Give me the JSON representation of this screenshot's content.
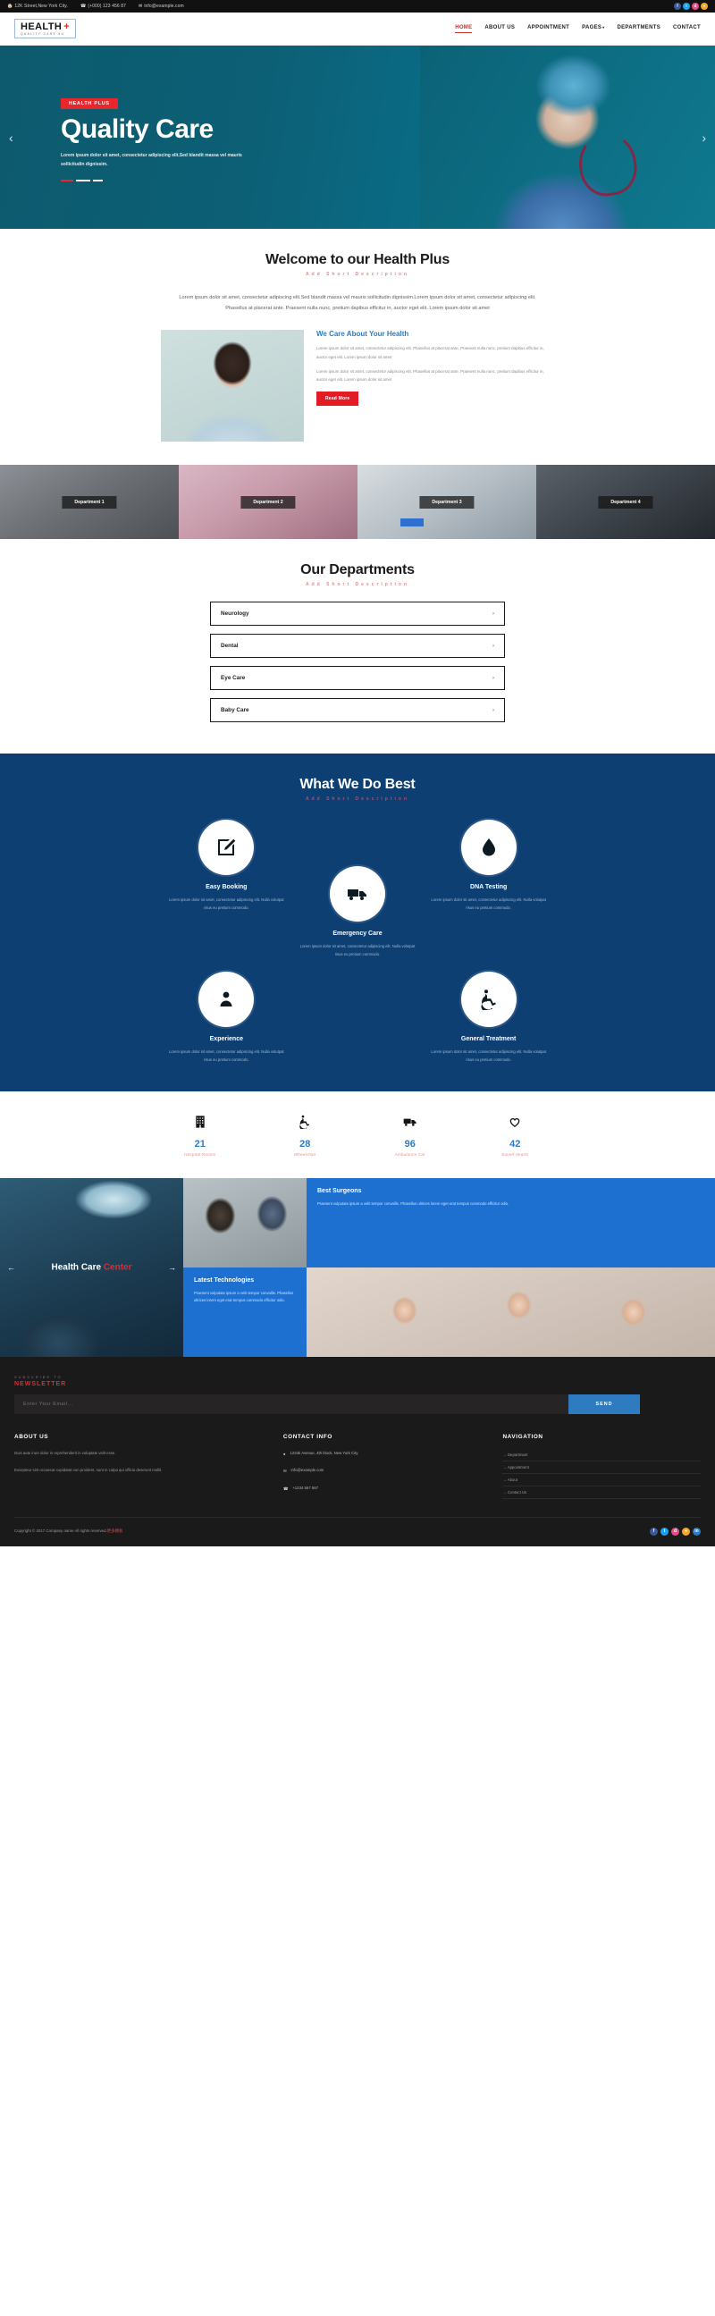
{
  "topbar": {
    "address": "12K Street,New York City.",
    "phone": "(+000) 123 456 87",
    "email": "info@example.com",
    "address_icon": "home-icon",
    "phone_icon": "phone-icon",
    "email_icon": "envelope-icon",
    "social": [
      {
        "name": "facebook-icon",
        "glyph": "f",
        "color": "#3b5998"
      },
      {
        "name": "twitter-icon",
        "glyph": "t",
        "color": "#1da1f2"
      },
      {
        "name": "dribbble-icon",
        "glyph": "d",
        "color": "#ea4c89"
      },
      {
        "name": "rss-icon",
        "glyph": "●",
        "color": "#f5a623"
      }
    ]
  },
  "header": {
    "logo_main": "HEALTH",
    "logo_cross": "+",
    "logo_sub": "QUALITY CARE 4U",
    "nav": [
      {
        "label": "HOME",
        "active": true,
        "caret": false
      },
      {
        "label": "ABOUT US",
        "active": false,
        "caret": false
      },
      {
        "label": "APPOINTMENT",
        "active": false,
        "caret": false
      },
      {
        "label": "PAGES",
        "active": false,
        "caret": true
      },
      {
        "label": "DEPARTMENTS",
        "active": false,
        "caret": false
      },
      {
        "label": "CONTACT",
        "active": false,
        "caret": false
      }
    ],
    "caret_glyph": "▾"
  },
  "hero": {
    "badge": "HEALTH PLUS",
    "title": "Quality Care",
    "subtitle": "Lorem ipsum dolor sit amet, consectetur adipiscing elit.Sed blandit massa vel mauris sollicitudin dignissim.",
    "prev_glyph": "‹",
    "next_glyph": "›"
  },
  "welcome": {
    "title": "Welcome to our Health Plus",
    "subtitle": "Add Short Description",
    "body": "Lorem ipsum dolor sit amet, consectetur adipiscing elit.Sed blandit massa vel mauris sollicitudin dignissim.Lorem ipsum dolor sit amet, consectetur adipiscing elit. Phasellus at placerat ante. Praesent nulla nunc, pretium dapibus efficitur in, auctor eget elit. Lorem ipsum dolor sit amet"
  },
  "care": {
    "title": "We Care About Your Health",
    "paragraph_1": "Lorem ipsum dolor sit amet, consectetur adipiscing elit. Phasellus at placerat ante. Praesent nulla nunc, pretium dapibus efficitur in, auctor eget elit. Lorem ipsum dolor sit amet",
    "paragraph_2": "Lorem ipsum dolor sit amet, consectetur adipiscing elit. Phasellus at placerat ante. Praesent nulla nunc, pretium dapibus efficitur in, auctor eget elit. Lorem ipsum dolor sit amet",
    "button": "Read More"
  },
  "gallery": {
    "items": [
      {
        "label": "Department 1"
      },
      {
        "label": "Department 2"
      },
      {
        "label": "Department 3"
      },
      {
        "label": "Department 4"
      }
    ]
  },
  "departments": {
    "title": "Our Departments",
    "subtitle": "Add Short Description",
    "plus_glyph": "›",
    "items": [
      {
        "label": "Neurology"
      },
      {
        "label": "Dental"
      },
      {
        "label": "Eye Care"
      },
      {
        "label": "Baby Care"
      }
    ]
  },
  "best": {
    "title": "What We Do Best",
    "subtitle": "Add Short Description",
    "body": "Lorem ipsum dolor sit amet, consectetur adipiscing elit. Nulla volutpat risus eu pretium commodo.",
    "items": [
      {
        "title": "Easy Booking",
        "icon": "pencil-square-icon"
      },
      {
        "title": "Emergency Care",
        "icon": "ambulance-icon"
      },
      {
        "title": "DNA Testing",
        "icon": "blood-drop-icon"
      },
      {
        "title": "Experience",
        "icon": "user-badge-icon"
      },
      {
        "title": "General Treatment",
        "icon": "wheelchair-icon"
      }
    ]
  },
  "counters": [
    {
      "value": "21",
      "label": "Hospital Rooms",
      "icon": "building-icon"
    },
    {
      "value": "28",
      "label": "Wheelchair",
      "icon": "wheelchair-icon"
    },
    {
      "value": "96",
      "label": "Ambulance Car",
      "icon": "ambulance-icon"
    },
    {
      "value": "42",
      "label": "Saved Hearts",
      "icon": "heart-icon"
    }
  ],
  "mosaic": {
    "left_label_1": "Health Care ",
    "left_label_2": "Center",
    "prev_glyph": "←",
    "next_glyph": "→",
    "surgeons_title": "Best Surgeons",
    "surgeons_body": "Praesent vulputate ipsum a velit tempor convallis. Phasellus ultrices lorem eget erat tempus commodo efficitur odio.",
    "tech_title": "Latest Technologies",
    "tech_body": "Praesent vulputate ipsum a velit tempor convallis. Phasellus ultrices lorem eget erat tempus commodo efficitur odio."
  },
  "newsletter": {
    "kicker": "Subscribe To",
    "title": "NEWSLETTER",
    "placeholder": "Enter Your Email...",
    "button": "SEND"
  },
  "footer": {
    "about_title": "ABOUT US",
    "about_p1": "Duis aute irure dolor in reprehenderit in voluptate velit esse.",
    "about_p2": "Excepteur sint occaecat cupidatat non proident, sunt in culpa qui officia deserunt mollit.",
    "contact_title": "CONTACT INFO",
    "contact_address": "1234k Avenue, 4th block, New York City.",
    "contact_email": "info@example.com",
    "contact_phone": "+1234 567 567",
    "address_icon": "map-pin-icon",
    "email_icon": "envelope-icon",
    "phone_icon": "phone-icon",
    "nav_title": "NAVIGATION",
    "nav_items": [
      {
        "label": "Departmant"
      },
      {
        "label": "Appointment"
      },
      {
        "label": "About"
      },
      {
        "label": "Contact Us"
      }
    ],
    "copyright_pre": "Copyright © 2017.Company name All rights reserved.",
    "copyright_link": "更多模板",
    "social": [
      {
        "name": "facebook-icon",
        "glyph": "f",
        "color": "#3b5998"
      },
      {
        "name": "twitter-icon",
        "glyph": "t",
        "color": "#1da1f2"
      },
      {
        "name": "dribbble-icon",
        "glyph": "d",
        "color": "#ea4c89"
      },
      {
        "name": "rss-icon",
        "glyph": "●",
        "color": "#f5a623"
      },
      {
        "name": "linkedin-icon",
        "glyph": "in",
        "color": "#2f7bbf"
      }
    ]
  }
}
